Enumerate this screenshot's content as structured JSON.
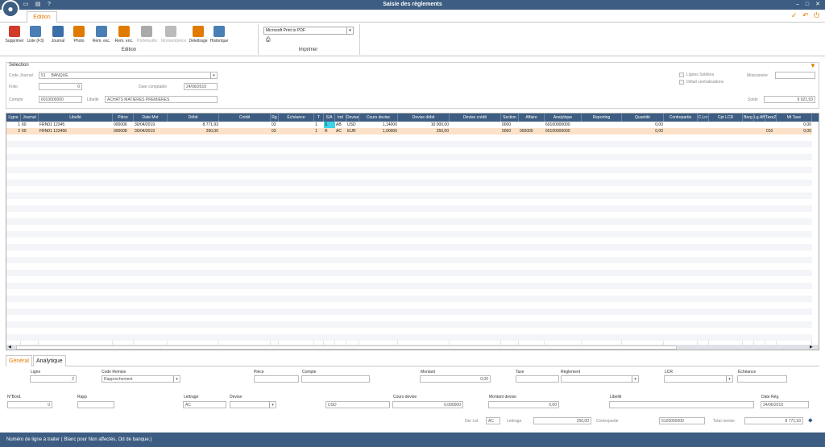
{
  "window": {
    "title": "Saisie des règlements"
  },
  "ribbon": {
    "tab": "Edition",
    "group_edition": "Edition",
    "group_imprimer": "Imprimer",
    "printer": "Microsoft Print to PDF",
    "buttons": [
      {
        "label": "Supprimer",
        "icon": "delete-icon",
        "color": "#d23b2a",
        "disabled": false
      },
      {
        "label": "Liste (F3)",
        "icon": "search-icon",
        "color": "#4a7fb5",
        "disabled": false
      },
      {
        "label": "Journal",
        "icon": "journal-icon",
        "color": "#3a6fa8",
        "disabled": false
      },
      {
        "label": "Photo",
        "icon": "photo-icon",
        "color": "#e07b00",
        "disabled": false
      },
      {
        "label": "Rem. esc.",
        "icon": "discount-icon",
        "color": "#4a7fb5",
        "disabled": false
      },
      {
        "label": "Rem. enc.",
        "icon": "discount-orange-icon",
        "color": "#e07b00",
        "disabled": false
      },
      {
        "label": "Portefeuille",
        "icon": "wallet-icon",
        "color": "#aaaaaa",
        "disabled": true
      },
      {
        "label": "Montant/pièce",
        "icon": "amount-icon",
        "color": "#bbbbbb",
        "disabled": true
      },
      {
        "label": "Délettrage",
        "icon": "unletter-icon",
        "color": "#e07b00",
        "disabled": false
      },
      {
        "label": "Historique",
        "icon": "history-icon",
        "color": "#4a7fb5",
        "disabled": false
      }
    ]
  },
  "selection": {
    "title": "Sélection",
    "code_journal_label": "Code Journal",
    "code_journal_value": "51",
    "code_journal_name": "BANQUE",
    "folio_label": "Folio",
    "folio_value": "0",
    "date_comptable_label": "Date comptable",
    "date_comptable_value": "24/06/2019",
    "compte_label": "Compte",
    "compte_value": "6010000000",
    "libelle_label": "Libellé",
    "libelle_value": "ACHATS MATIERES PREMIERES",
    "lignes_soldees_label": "Lignes Soldées",
    "detail_centralisations_label": "Détail centralisations",
    "mois_annee_label": "Mois/année",
    "mois_annee_value": "",
    "solde_label": "Solde",
    "solde_value": "9 021,93"
  },
  "grid": {
    "columns": [
      "Ligne",
      "Journal",
      "Libellé",
      "Pièce",
      "Date Mvt",
      "Débit",
      "Crédit",
      "Rg",
      "Échéance",
      "T",
      "S/A",
      "Ind",
      "Devise",
      "Cours devise",
      "Devise débit",
      "Devise crédit",
      "Section",
      "Affaire",
      "Analytique",
      "Reporting",
      "Quantité",
      "Contrepartie",
      "C.Lcr",
      "Cpt LCR",
      "Borg",
      "Lg.Aff.",
      "Taxe2",
      "Mt Taxe"
    ],
    "rows": [
      {
        "ligne": "1",
        "journal": "60",
        "libelle": "FRN01 12345",
        "piece": "000006",
        "date": "30/04/2019",
        "debit": "8 771,93",
        "credit": "",
        "rg": "03",
        "echeance": "",
        "t": "1",
        "sa": "S",
        "ind": "AB",
        "devise": "USD",
        "cours": "1,14000",
        "dev_debit": "10 000,00",
        "dev_credit": "",
        "section": "0000",
        "affaire": "",
        "analytique": "60100000000",
        "reporting": "",
        "quantite": "0,00",
        "contrepartie": "",
        "clcr": "",
        "cptlcr": "",
        "borg": "",
        "lgaff": "",
        "taxe2": "",
        "mttaxe": "0,00"
      },
      {
        "ligne": "2",
        "journal": "60",
        "libelle": "FRN01 123456",
        "piece": "000008",
        "date": "30/04/2019",
        "debit": "250,00",
        "credit": "",
        "rg": "03",
        "echeance": "",
        "t": "1",
        "sa": "R",
        "ind": "AC",
        "devise": "EUR",
        "cours": "1,00000",
        "dev_debit": "250,00",
        "dev_credit": "",
        "section": "0000",
        "affaire": "000005",
        "analytique": "60100000000",
        "reporting": "",
        "quantite": "0,00",
        "contrepartie": "",
        "clcr": "",
        "cptlcr": "",
        "borg": "",
        "lgaff": "",
        "taxe2": "010",
        "mttaxe": "0,00"
      }
    ]
  },
  "bottom": {
    "tabs": [
      "Général",
      "Analytique"
    ],
    "ligne_label": "Ligne",
    "ligne_value": "2",
    "code_remise_label": "Code Remise",
    "code_remise_value": "Rapprochement",
    "piece_label": "Pièce",
    "piece_value": "",
    "compte_label": "Compte",
    "compte_value": "",
    "montant_label": "Montant",
    "montant_value": "0,00",
    "taxe_label": "Taxe",
    "taxe_value": "",
    "reglement_label": "Règlement",
    "reglement_value": "",
    "lcr_label": "LCR",
    "lcr_value": "",
    "echeance_label": "Échéance",
    "echeance_value": "",
    "nbord_label": "N°Bord.",
    "nbord_value": "0",
    "rapp_label": "Rapp",
    "rapp_value": "",
    "lettrage_label": "Lettrage",
    "lettrage_value": "AC",
    "devise_label": "Devise",
    "devise_value": "",
    "devise_code": "USD",
    "cours_devise_label": "Cours devise",
    "cours_devise_value": "0,000000",
    "montant_devise_label": "Montant devise",
    "montant_devise_value": "0,00",
    "libelle_label": "Libellé",
    "libelle_value": "",
    "date_reg_label": "Date Rég.",
    "date_reg_value": "24/06/2019",
    "der_let_label": "Der Let",
    "der_let_value": "AC",
    "lettrage2_label": "Lettrage",
    "lettrage2_value": "250,00",
    "contrepartie_label": "Contrepartie",
    "contrepartie_value": "5120000000",
    "total_remise_label": "Total remise",
    "total_remise_value": "8 771,93"
  },
  "status": {
    "text": "Numéro de ligne à traiter  ( Blanc pour Non affectés, Od de banque.)"
  }
}
